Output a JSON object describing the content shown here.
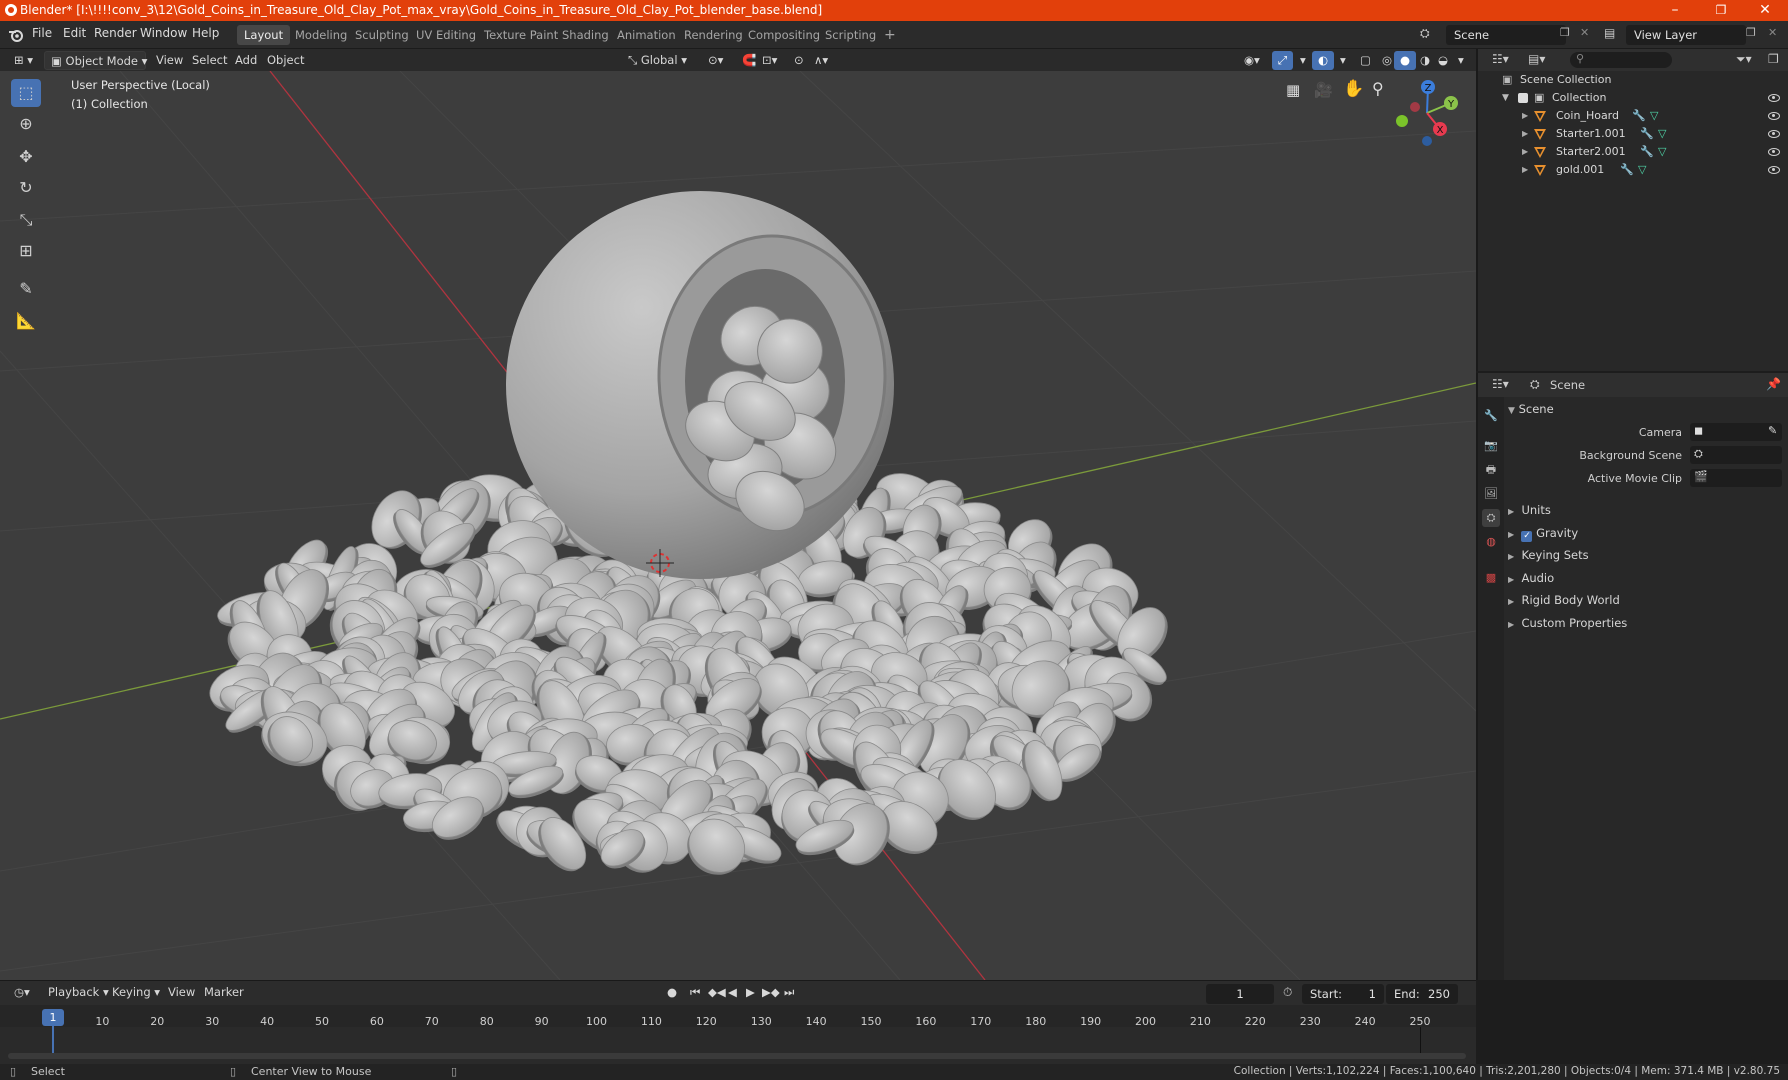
{
  "window": {
    "title": "Blender* [I:\\!!!!conv_3\\12\\Gold_Coins_in_Treasure_Old_Clay_Pot_max_vray\\Gold_Coins_in_Treasure_Old_Clay_Pot_blender_base.blend]",
    "controls": [
      "–",
      "❐",
      "✕"
    ]
  },
  "menubar": [
    "File",
    "Edit",
    "Render",
    "Window",
    "Help"
  ],
  "workspaces": [
    {
      "label": "Layout",
      "active": true
    },
    {
      "label": "Modeling",
      "active": false
    },
    {
      "label": "Sculpting",
      "active": false
    },
    {
      "label": "UV Editing",
      "active": false
    },
    {
      "label": "Texture Paint",
      "active": false
    },
    {
      "label": "Shading",
      "active": false
    },
    {
      "label": "Animation",
      "active": false
    },
    {
      "label": "Rendering",
      "active": false
    },
    {
      "label": "Compositing",
      "active": false
    },
    {
      "label": "Scripting",
      "active": false
    }
  ],
  "add_workspace": "+",
  "scene_field": "Scene",
  "view_layer_field": "View Layer",
  "viewport_header": {
    "mode": "Object Mode",
    "menus": [
      "View",
      "Select",
      "Add",
      "Object"
    ],
    "transform_orientation": "Global"
  },
  "viewport": {
    "perspective": "User Perspective (Local)",
    "collection": "(1) Collection",
    "gizmo_axes": {
      "x": "X",
      "y": "Y",
      "z": "Z"
    },
    "colors": {
      "x_axis": "#e83a4f",
      "y_axis": "#8bc34a",
      "z_axis": "#3b7ddb",
      "active_tool": "#4772b3"
    }
  },
  "toolbar_tools": [
    "select-box-icon",
    "cursor-icon",
    "move-icon",
    "rotate-icon",
    "scale-icon",
    "transform-icon",
    "annotate-icon",
    "measure-icon"
  ],
  "outliner": {
    "root": "Scene Collection",
    "collection": "Collection",
    "items": [
      {
        "name": "Coin_Hoard"
      },
      {
        "name": "Starter1.001"
      },
      {
        "name": "Starter2.001"
      },
      {
        "name": "gold.001"
      }
    ]
  },
  "properties": {
    "header": "Scene",
    "section": "Scene",
    "fields": [
      {
        "label": "Camera"
      },
      {
        "label": "Background Scene"
      },
      {
        "label": "Active Movie Clip"
      }
    ],
    "panels": [
      {
        "label": "Units",
        "checkbox": false
      },
      {
        "label": "Gravity",
        "checkbox": true
      },
      {
        "label": "Keying Sets",
        "checkbox": false
      },
      {
        "label": "Audio",
        "checkbox": false
      },
      {
        "label": "Rigid Body World",
        "checkbox": false
      },
      {
        "label": "Custom Properties",
        "checkbox": false
      }
    ]
  },
  "timeline": {
    "menus": [
      "Playback",
      "Keying",
      "View",
      "Marker"
    ],
    "current_frame": "1",
    "start_label": "Start:",
    "start": "1",
    "end_label": "End:",
    "end": "250",
    "ticks": [
      "1",
      "10",
      "20",
      "30",
      "40",
      "50",
      "60",
      "70",
      "80",
      "90",
      "100",
      "110",
      "120",
      "130",
      "140",
      "150",
      "160",
      "170",
      "180",
      "190",
      "200",
      "210",
      "220",
      "230",
      "240",
      "250"
    ]
  },
  "statusbar": {
    "select": "Select",
    "center_view": "Center View to Mouse",
    "stats": "Collection | Verts:1,102,224 | Faces:1,100,640 | Tris:2,201,280 | Objects:0/4 | Mem: 371.4 MB | v2.80.75"
  }
}
